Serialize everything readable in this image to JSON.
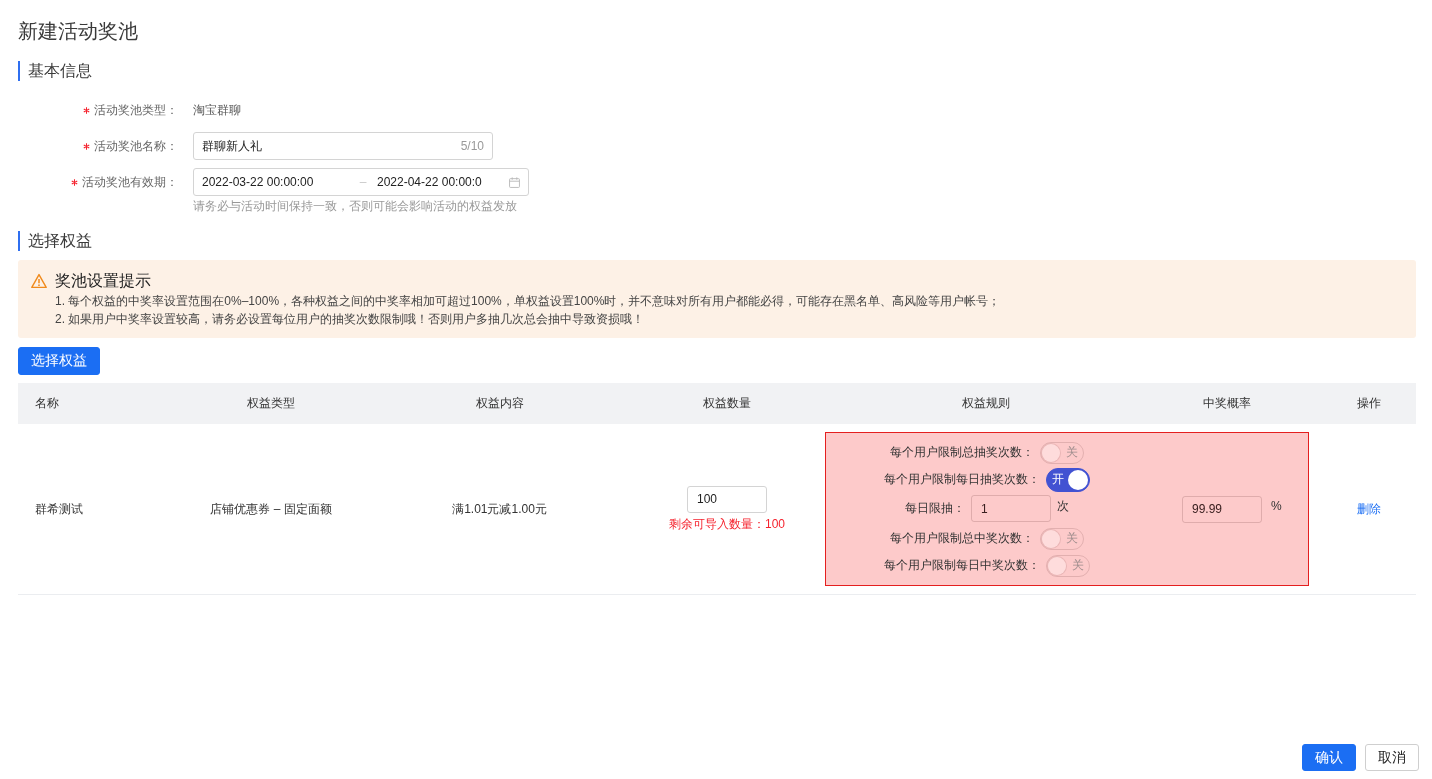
{
  "page_title": "新建活动奖池",
  "basic_info": {
    "heading": "基本信息",
    "fields": [
      {
        "kind": "text",
        "required": true,
        "label": "活动奖池类型：",
        "value": "淘宝群聊"
      },
      {
        "kind": "input",
        "required": true,
        "label": "活动奖池名称：",
        "value": "群聊新人礼",
        "counter": "5/10"
      },
      {
        "kind": "date_range",
        "required": true,
        "label": "活动奖池有效期：",
        "start": "2022-03-22 00:00:00",
        "separator": "–",
        "end": "2022-04-22 00:00:0",
        "hint": "请务必与活动时间保持一致，否则可能会影响活动的权益发放"
      }
    ]
  },
  "benefits": {
    "heading": "选择权益",
    "alert": {
      "title": "奖池设置提示",
      "lines": [
        "1. 每个权益的中奖率设置范围在0%–100%，各种权益之间的中奖率相加可超过100%，单权益设置100%时，并不意味对所有用户都能必得，可能存在黑名单、高风险等用户帐号；",
        "2. 如果用户中奖率设置较高，请务必设置每位用户的抽奖次数限制哦！否则用户多抽几次总会抽中导致资损哦！"
      ]
    },
    "select_button": "选择权益",
    "table": {
      "columns": [
        "名称",
        "权益类型",
        "权益内容",
        "权益数量",
        "权益规则",
        "中奖概率",
        "操作"
      ],
      "rows": [
        {
          "name": "群希测试",
          "type": "店铺优惠券 – 固定面额",
          "content": "满1.01元减1.00元",
          "quantity": {
            "value": "100",
            "remaining": "剩余可导入数量：100"
          },
          "highlighted": true,
          "rules": [
            {
              "kind": "switch",
              "label": "每个用户限制总抽奖次数：",
              "on": false,
              "text": "关"
            },
            {
              "kind": "switch",
              "label": "每个用户限制每日抽奖次数：",
              "on": true,
              "text": "开"
            },
            {
              "kind": "limit",
              "label": "每日限抽：",
              "value": "1",
              "unit": "次"
            },
            {
              "kind": "switch",
              "label": "每个用户限制总中奖次数：",
              "on": false,
              "text": "关"
            },
            {
              "kind": "switch",
              "label": "每个用户限制每日中奖次数：",
              "on": false,
              "text": "关"
            }
          ],
          "probability": {
            "value": "99.99",
            "unit": "%"
          },
          "action": "删除"
        }
      ]
    }
  },
  "footer_buttons": [
    {
      "kind": "primary",
      "label": "确认"
    },
    {
      "kind": "default",
      "label": "取消"
    }
  ]
}
